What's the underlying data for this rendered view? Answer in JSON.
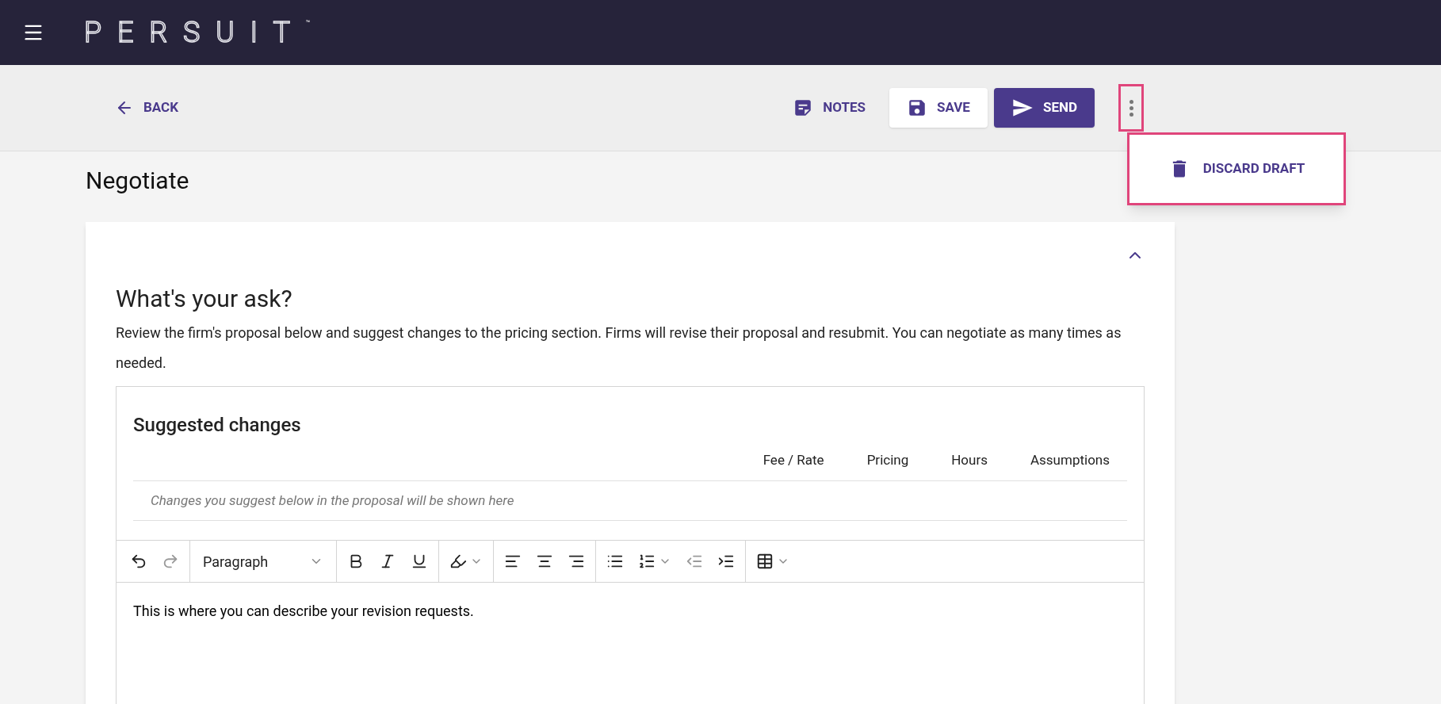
{
  "header": {
    "logo": "PERSUIT",
    "trademark": "™"
  },
  "action_bar": {
    "back": "BACK",
    "notes": "NOTES",
    "save": "SAVE",
    "send": "SEND",
    "more_menu": {
      "highlighted": true,
      "open": true,
      "items": [
        {
          "label": "DISCARD DRAFT",
          "highlighted": true
        }
      ]
    }
  },
  "page_title": "Negotiate",
  "card": {
    "expanded": true,
    "heading": "What's your ask?",
    "description": "Review the firm's proposal below and suggest changes to the pricing section. Firms will revise their proposal and resubmit. You can negotiate as many times as needed.",
    "suggested_changes": {
      "title": "Suggested changes",
      "columns": [
        "Fee / Rate",
        "Pricing",
        "Hours",
        "Assumptions"
      ],
      "empty_message": "Changes you suggest below in the proposal will be shown here"
    },
    "editor": {
      "toolbar": [
        [
          {
            "kind": "undo",
            "disabled": false
          },
          {
            "kind": "redo",
            "disabled": true
          }
        ],
        [
          {
            "kind": "block-format",
            "value": "Paragraph"
          }
        ],
        [
          {
            "kind": "bold",
            "disabled": false
          },
          {
            "kind": "italic",
            "disabled": false
          },
          {
            "kind": "underline",
            "disabled": false
          }
        ],
        [
          {
            "kind": "highlight",
            "disabled": false,
            "caret": true
          }
        ],
        [
          {
            "kind": "align-left",
            "disabled": false
          },
          {
            "kind": "align-center",
            "disabled": false
          },
          {
            "kind": "align-right",
            "disabled": false
          }
        ],
        [
          {
            "kind": "bullets",
            "disabled": false
          },
          {
            "kind": "numbers",
            "disabled": false,
            "caret": true
          },
          {
            "kind": "outdent",
            "disabled": true
          },
          {
            "kind": "indent",
            "disabled": false
          }
        ],
        [
          {
            "kind": "table",
            "disabled": false,
            "caret": true
          }
        ]
      ],
      "content": "This is where you can describe your revision requests."
    }
  }
}
